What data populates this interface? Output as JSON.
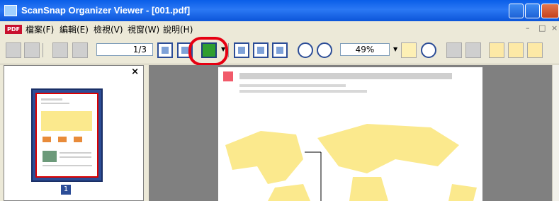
{
  "window": {
    "title": "ScanSnap Organizer Viewer - [001.pdf]"
  },
  "menu": {
    "pdf_badge": "PDF",
    "items": [
      "檔案(F)",
      "編輯(E)",
      "檢視(V)",
      "視窗(W)",
      "說明(H)"
    ]
  },
  "toolbar": {
    "page_field": "1/3",
    "zoom_field": "49%"
  },
  "thumbnails": {
    "close_label": "×",
    "page_label": "1"
  },
  "colors": {
    "highlight": "#e60012",
    "title_blue": "#0a5ee8",
    "map_yellow": "#fbe98d"
  }
}
